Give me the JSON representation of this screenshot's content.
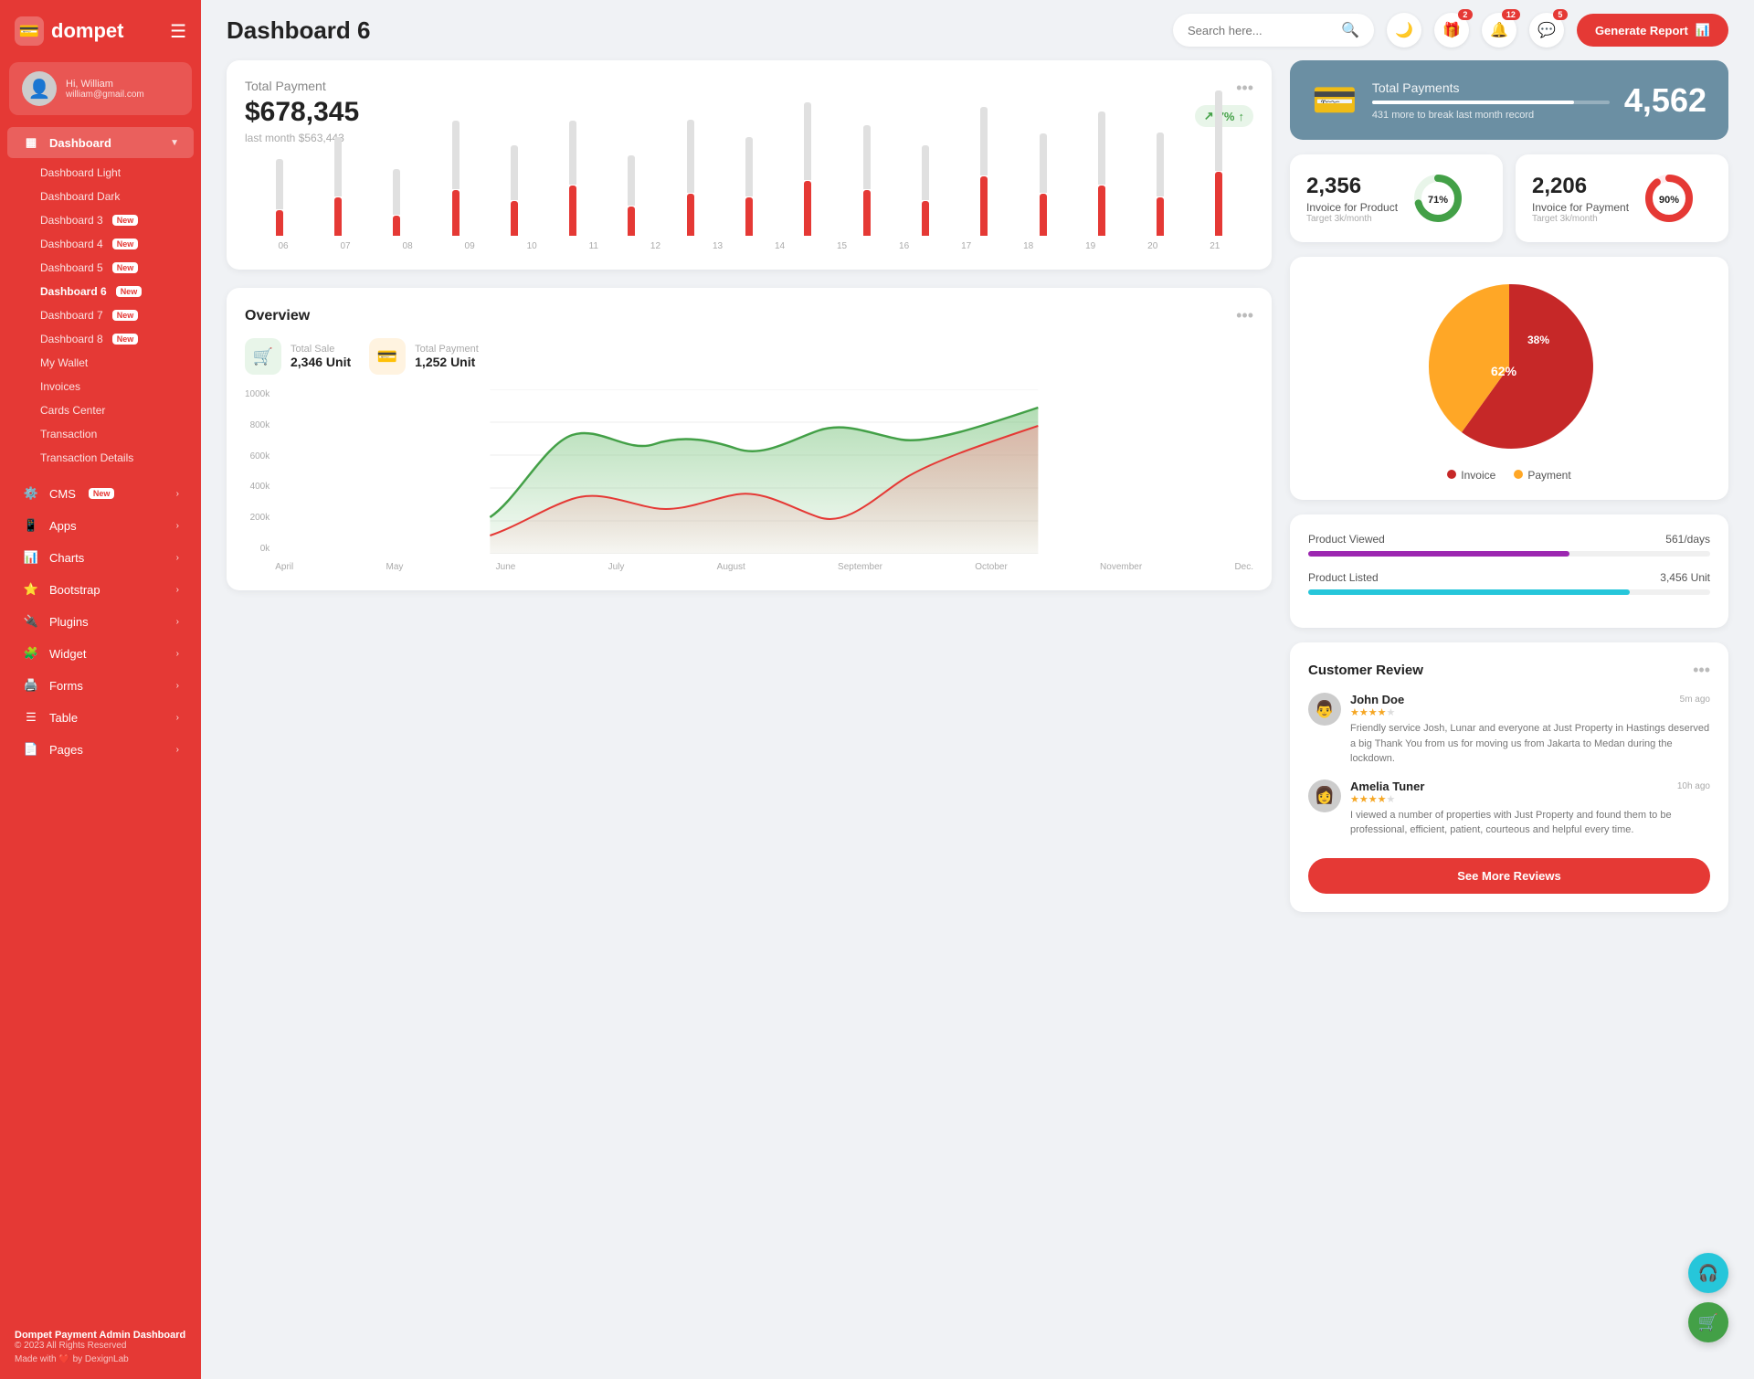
{
  "sidebar": {
    "logo": "dompet",
    "logo_icon": "💳",
    "user": {
      "greeting": "Hi, William",
      "name": "William",
      "email": "william@gmail.com",
      "avatar": "👤"
    },
    "nav": {
      "dashboard_label": "Dashboard",
      "items": [
        {
          "label": "Dashboard Light",
          "id": "dashboard-light",
          "sub": true
        },
        {
          "label": "Dashboard Dark",
          "id": "dashboard-dark",
          "sub": true
        },
        {
          "label": "Dashboard 3",
          "id": "dashboard-3",
          "sub": true,
          "badge": "New"
        },
        {
          "label": "Dashboard 4",
          "id": "dashboard-4",
          "sub": true,
          "badge": "New"
        },
        {
          "label": "Dashboard 5",
          "id": "dashboard-5",
          "sub": true,
          "badge": "New"
        },
        {
          "label": "Dashboard 6",
          "id": "dashboard-6",
          "sub": true,
          "badge": "New",
          "active": true
        },
        {
          "label": "Dashboard 7",
          "id": "dashboard-7",
          "sub": true,
          "badge": "New"
        },
        {
          "label": "Dashboard 8",
          "id": "dashboard-8",
          "sub": true,
          "badge": "New"
        },
        {
          "label": "My Wallet",
          "id": "my-wallet",
          "sub": true
        },
        {
          "label": "Invoices",
          "id": "invoices",
          "sub": true
        },
        {
          "label": "Cards Center",
          "id": "cards-center",
          "sub": true
        },
        {
          "label": "Transaction",
          "id": "transaction",
          "sub": true
        },
        {
          "label": "Transaction Details",
          "id": "transaction-details",
          "sub": true
        }
      ],
      "groups": [
        {
          "label": "CMS",
          "id": "cms",
          "badge": "New",
          "icon": "⚙️",
          "arrow": true
        },
        {
          "label": "Apps",
          "id": "apps",
          "icon": "📱",
          "arrow": true
        },
        {
          "label": "Charts",
          "id": "charts",
          "icon": "📊",
          "arrow": true
        },
        {
          "label": "Bootstrap",
          "id": "bootstrap",
          "icon": "⭐",
          "arrow": true
        },
        {
          "label": "Plugins",
          "id": "plugins",
          "icon": "🔌",
          "arrow": true
        },
        {
          "label": "Widget",
          "id": "widget",
          "icon": "🧩",
          "arrow": true
        },
        {
          "label": "Forms",
          "id": "forms",
          "icon": "🖨️",
          "arrow": true
        },
        {
          "label": "Table",
          "id": "table",
          "icon": "☰",
          "arrow": true
        },
        {
          "label": "Pages",
          "id": "pages",
          "icon": "📄",
          "arrow": true
        }
      ]
    },
    "footer": {
      "brand": "Dompet Payment Admin Dashboard",
      "copyright": "© 2023 All Rights Reserved",
      "made_with": "Made with",
      "by": "by DexignLab"
    }
  },
  "topbar": {
    "title": "Dashboard 6",
    "search_placeholder": "Search here...",
    "badges": {
      "gift": "2",
      "bell": "12",
      "chat": "5"
    },
    "btn_generate": "Generate Report"
  },
  "total_payment": {
    "title": "Total Payment",
    "amount": "$678,345",
    "last_month_label": "last month $563,443",
    "trend": "7%",
    "trend_up": true,
    "bars": [
      {
        "gray": 60,
        "red": 30
      },
      {
        "gray": 70,
        "red": 45
      },
      {
        "gray": 55,
        "red": 25
      },
      {
        "gray": 80,
        "red": 55
      },
      {
        "gray": 65,
        "red": 40
      },
      {
        "gray": 75,
        "red": 60
      },
      {
        "gray": 60,
        "red": 35
      },
      {
        "gray": 85,
        "red": 50
      },
      {
        "gray": 70,
        "red": 45
      },
      {
        "gray": 90,
        "red": 65
      },
      {
        "gray": 75,
        "red": 55
      },
      {
        "gray": 65,
        "red": 40
      },
      {
        "gray": 80,
        "red": 70
      },
      {
        "gray": 70,
        "red": 50
      },
      {
        "gray": 85,
        "red": 60
      },
      {
        "gray": 75,
        "red": 45
      },
      {
        "gray": 90,
        "red": 75
      }
    ],
    "bar_labels": [
      "06",
      "07",
      "08",
      "09",
      "10",
      "11",
      "12",
      "13",
      "14",
      "15",
      "16",
      "17",
      "18",
      "19",
      "20",
      "21"
    ]
  },
  "blue_card": {
    "title": "Total Payments",
    "sub": "431 more to break last month record",
    "value": "4,562",
    "progress_pct": 85,
    "icon": "💳"
  },
  "invoice_product": {
    "value": "2,356",
    "label": "Invoice for Product",
    "target": "Target 3k/month",
    "pct": 71,
    "color": "#43a047"
  },
  "invoice_payment": {
    "value": "2,206",
    "label": "Invoice for Payment",
    "target": "Target 3k/month",
    "pct": 90,
    "color": "#e53935"
  },
  "overview": {
    "title": "Overview",
    "stat1_label": "Total Sale",
    "stat1_value": "2,346 Unit",
    "stat2_label": "Total Payment",
    "stat2_value": "1,252 Unit",
    "y_labels": [
      "1000k",
      "800k",
      "600k",
      "400k",
      "200k",
      "0k"
    ],
    "x_labels": [
      "April",
      "May",
      "June",
      "July",
      "August",
      "September",
      "October",
      "November",
      "Dec."
    ]
  },
  "pie_chart": {
    "invoice_pct": 62,
    "payment_pct": 38,
    "invoice_label": "Invoice",
    "payment_label": "Payment",
    "invoice_color": "#c62828",
    "payment_color": "#ffa726"
  },
  "product_metrics": {
    "viewed_label": "Product Viewed",
    "viewed_value": "561/days",
    "viewed_color": "#9c27b0",
    "viewed_pct": 65,
    "listed_label": "Product Listed",
    "listed_value": "3,456 Unit",
    "listed_color": "#26c6da",
    "listed_pct": 80
  },
  "customer_review": {
    "title": "Customer Review",
    "reviews": [
      {
        "name": "John Doe",
        "stars": 4,
        "time": "5m ago",
        "text": "Friendly service Josh, Lunar and everyone at Just Property in Hastings deserved a big Thank You from us for moving us from Jakarta to Medan during the lockdown.",
        "avatar": "👨"
      },
      {
        "name": "Amelia Tuner",
        "stars": 4,
        "time": "10h ago",
        "text": "I viewed a number of properties with Just Property and found them to be professional, efficient, patient, courteous and helpful every time.",
        "avatar": "👩"
      }
    ],
    "btn_more": "See More Reviews"
  }
}
